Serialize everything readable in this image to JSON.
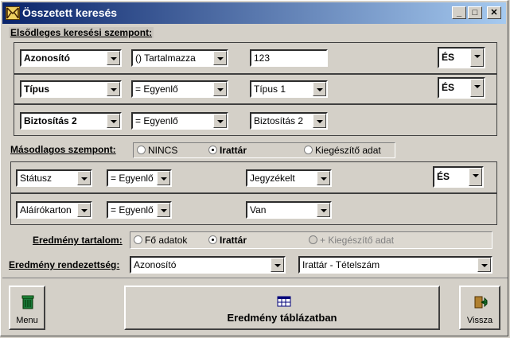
{
  "window": {
    "title": "Összetett keresés"
  },
  "primary": {
    "label": "Elsődleges keresési szempont:",
    "rows": [
      {
        "field": "Azonosító",
        "operator": "() Tartalmazza",
        "value": "123",
        "logic": "ÉS"
      },
      {
        "field": "Típus",
        "operator": "= Egyenlő",
        "value": "Típus 1",
        "logic": "ÉS"
      },
      {
        "field": "Biztosítás 2",
        "operator": "= Egyenlő",
        "value": "Biztosítás 2"
      }
    ]
  },
  "secondary": {
    "label": "Másodlagos szempont:",
    "options": [
      {
        "label": "NINCS",
        "selected": false
      },
      {
        "label": "Irattár",
        "selected": true
      },
      {
        "label": "Kiegészítő adat",
        "selected": false
      }
    ],
    "rows": [
      {
        "field": "Státusz",
        "operator": "= Egyenlő",
        "value": "Jegyzékelt",
        "logic": "ÉS"
      },
      {
        "field": "Aláírókarton",
        "operator": "= Egyenlő",
        "value": "Van"
      }
    ]
  },
  "result_content": {
    "label": "Eredmény tartalom:",
    "options": [
      {
        "label": "Fő adatok",
        "selected": false
      },
      {
        "label": "Irattár",
        "selected": true
      },
      {
        "label": "+ Kiegészítő adat",
        "selected": false,
        "disabled": true
      }
    ]
  },
  "result_order": {
    "label": "Eredmény rendezettség:",
    "first": "Azonosító",
    "second": "Irattár - Tételszám"
  },
  "buttons": {
    "menu": "Menu",
    "result_table": "Eredmény táblázatban",
    "back": "Vissza"
  },
  "icons": {
    "app": "envelope-icon",
    "menu": "trash-bin-icon",
    "table": "table-grid-icon",
    "back": "exit-door-icon"
  }
}
